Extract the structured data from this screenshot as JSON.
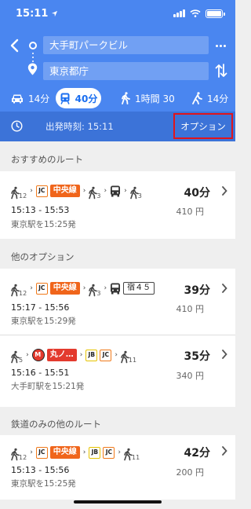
{
  "status_bar": {
    "time": "15:11"
  },
  "header": {
    "origin": "大手町パークビル",
    "destination": "東京都庁"
  },
  "modes": [
    {
      "name": "drive",
      "label": "14分"
    },
    {
      "name": "transit",
      "label": "40分",
      "selected": true
    },
    {
      "name": "walk",
      "label": "1時間 30"
    },
    {
      "name": "bike",
      "label": "14分"
    }
  ],
  "depart": {
    "label": "出発時刻: 15:11",
    "options_label": "オプション"
  },
  "sections": {
    "recommended": "おすすめのルート",
    "other": "他のオプション",
    "rail_only": "鉄道のみの他のルート"
  },
  "routes": [
    {
      "walk1": "12",
      "badge1": "JC",
      "line": "中央線",
      "walk2": "3",
      "walk3": "3",
      "duration": "40分",
      "times": "15:13 - 15:53",
      "fare": "410 円",
      "note": "東京駅を15:25発"
    },
    {
      "walk1": "12",
      "badge1": "JC",
      "line": "中央線",
      "walk2": "3",
      "bus": "宿４５",
      "duration": "39分",
      "times": "15:17 - 15:56",
      "fare": "410 円",
      "note": "東京駅を15:29発"
    },
    {
      "walk1": "5",
      "line": "丸ノ…",
      "badge1": "JB",
      "badge2": "JC",
      "walk2": "11",
      "duration": "35分",
      "times": "15:16 - 15:51",
      "fare": "340 円",
      "note": "大手町駅を15:21発"
    },
    {
      "walk1": "12",
      "badge1": "JC",
      "line": "中央線",
      "badge2": "JB",
      "badge3": "JC",
      "walk2": "11",
      "duration": "42分",
      "times": "15:13 - 15:56",
      "fare": "200 円",
      "note": "東京駅を15:25発"
    }
  ]
}
